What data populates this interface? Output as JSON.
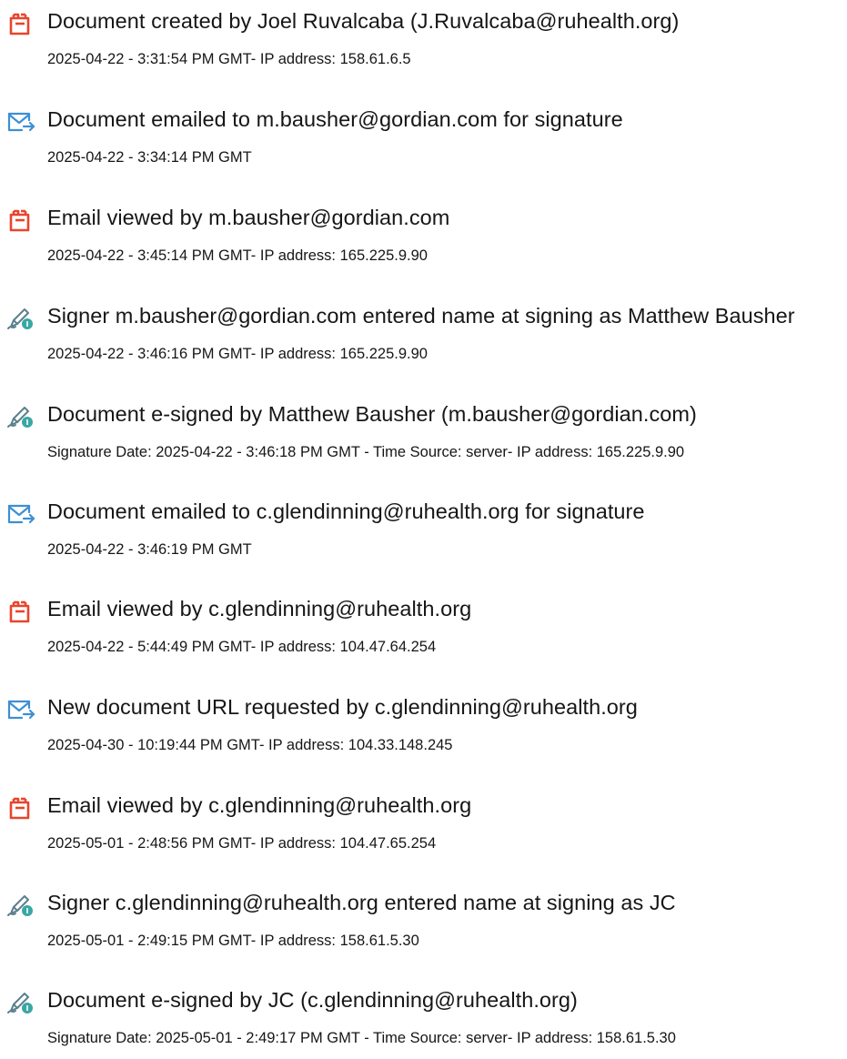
{
  "events": [
    {
      "icon": "document-created-icon",
      "title": "Document created by Joel Ruvalcaba (J.Ruvalcaba@ruhealth.org)",
      "detail": "2025-04-22 - 3:31:54 PM GMT- IP address: 158.61.6.5"
    },
    {
      "icon": "email-sent-icon",
      "title": "Document emailed to m.bausher@gordian.com for signature",
      "detail": "2025-04-22 - 3:34:14 PM GMT"
    },
    {
      "icon": "document-viewed-icon",
      "title": "Email viewed by m.bausher@gordian.com",
      "detail": "2025-04-22 - 3:45:14 PM GMT- IP address: 165.225.9.90"
    },
    {
      "icon": "signature-pen-icon",
      "title": "Signer m.bausher@gordian.com entered name at signing as Matthew Bausher",
      "detail": "2025-04-22 - 3:46:16 PM GMT- IP address: 165.225.9.90"
    },
    {
      "icon": "signature-pen-icon",
      "title": "Document e-signed by Matthew Bausher (m.bausher@gordian.com)",
      "detail": "Signature Date: 2025-04-22 - 3:46:18 PM GMT - Time Source: server- IP address: 165.225.9.90"
    },
    {
      "icon": "email-sent-icon",
      "title": "Document emailed to c.glendinning@ruhealth.org for signature",
      "detail": "2025-04-22 - 3:46:19 PM GMT"
    },
    {
      "icon": "document-viewed-icon",
      "title": "Email viewed by c.glendinning@ruhealth.org",
      "detail": "2025-04-22 - 5:44:49 PM GMT- IP address: 104.47.64.254"
    },
    {
      "icon": "email-sent-icon",
      "title": "New document URL requested by c.glendinning@ruhealth.org",
      "detail": "2025-04-30 - 10:19:44 PM GMT- IP address: 104.33.148.245"
    },
    {
      "icon": "document-viewed-icon",
      "title": "Email viewed by c.glendinning@ruhealth.org",
      "detail": "2025-05-01 - 2:48:56 PM GMT- IP address: 104.47.65.254"
    },
    {
      "icon": "signature-pen-icon",
      "title": "Signer c.glendinning@ruhealth.org entered name at signing as JC",
      "detail": "2025-05-01 - 2:49:15 PM GMT- IP address: 158.61.5.30"
    },
    {
      "icon": "signature-pen-icon",
      "title": "Document e-signed by JC (c.glendinning@ruhealth.org)",
      "detail": "Signature Date: 2025-05-01 - 2:49:17 PM GMT - Time Source: server- IP address: 158.61.5.30"
    }
  ],
  "colors": {
    "document_icon": "#e8452c",
    "email_icon": "#3d8fd4",
    "signature_icon": "#3aa7a4",
    "text": "#161616"
  }
}
